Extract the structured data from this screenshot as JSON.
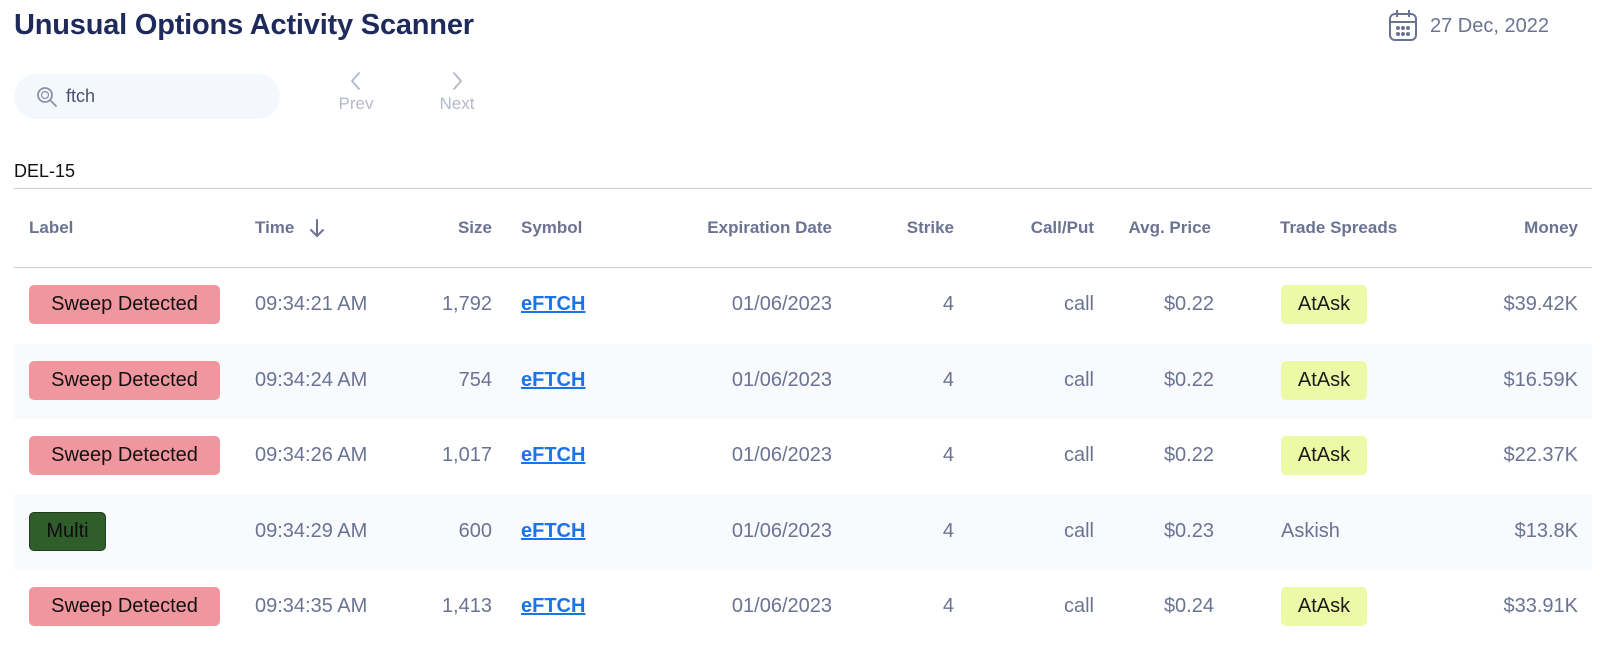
{
  "header": {
    "title": "Unusual Options Activity Scanner",
    "date": "27 Dec, 2022",
    "calendar_icon": "calendar-icon"
  },
  "search": {
    "value": "ftch",
    "placeholder": "",
    "icon": "search-icon"
  },
  "pager": {
    "prev_label": "Prev",
    "next_label": "Next"
  },
  "section_label": "DEL-15",
  "table": {
    "columns": {
      "label": "Label",
      "time": "Time",
      "size": "Size",
      "symbol": "Symbol",
      "expiration": "Expiration Date",
      "strike": "Strike",
      "callput": "Call/Put",
      "avgprice": "Avg. Price",
      "spreads": "Trade Spreads",
      "money": "Money"
    },
    "sort": {
      "column": "time",
      "direction": "descending",
      "icon": "arrow-down-icon"
    },
    "rows": [
      {
        "label": "Sweep Detected",
        "label_type": "sweep",
        "time": "09:34:21 AM",
        "size": "1,792",
        "symbol": "eFTCH",
        "expiration": "01/06/2023",
        "strike": "4",
        "callput": "call",
        "avgprice": "$0.22",
        "spread": "AtAsk",
        "spread_badge": true,
        "money": "$39.42K"
      },
      {
        "label": "Sweep Detected",
        "label_type": "sweep",
        "time": "09:34:24 AM",
        "size": "754",
        "symbol": "eFTCH",
        "expiration": "01/06/2023",
        "strike": "4",
        "callput": "call",
        "avgprice": "$0.22",
        "spread": "AtAsk",
        "spread_badge": true,
        "money": "$16.59K"
      },
      {
        "label": "Sweep Detected",
        "label_type": "sweep",
        "time": "09:34:26 AM",
        "size": "1,017",
        "symbol": "eFTCH",
        "expiration": "01/06/2023",
        "strike": "4",
        "callput": "call",
        "avgprice": "$0.22",
        "spread": "AtAsk",
        "spread_badge": true,
        "money": "$22.37K"
      },
      {
        "label": "Multi",
        "label_type": "multi",
        "time": "09:34:29 AM",
        "size": "600",
        "symbol": "eFTCH",
        "expiration": "01/06/2023",
        "strike": "4",
        "callput": "call",
        "avgprice": "$0.23",
        "spread": "Askish",
        "spread_badge": false,
        "money": "$13.8K"
      },
      {
        "label": "Sweep Detected",
        "label_type": "sweep",
        "time": "09:34:35 AM",
        "size": "1,413",
        "symbol": "eFTCH",
        "expiration": "01/06/2023",
        "strike": "4",
        "callput": "call",
        "avgprice": "$0.24",
        "spread": "AtAsk",
        "spread_badge": true,
        "money": "$33.91K"
      }
    ]
  },
  "colors": {
    "title": "#1f2a5c",
    "sweep_badge": "#f0969e",
    "multi_badge": "#2f5e2a",
    "spread_badge": "#ecfaa7",
    "link": "#1a73e8"
  }
}
